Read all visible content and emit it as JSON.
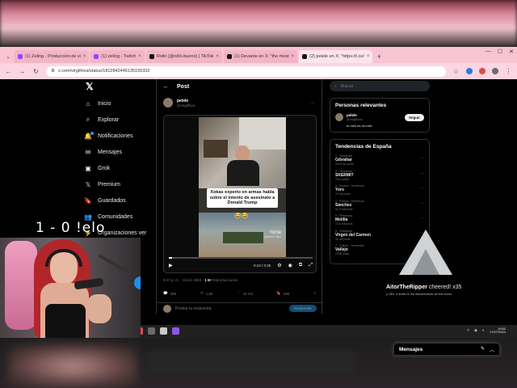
{
  "browser": {
    "tabs": [
      {
        "label": "(1) Zeling - Producción de vi",
        "color": "#9146ff",
        "active": false
      },
      {
        "label": "(1) zeling - Twitch",
        "color": "#9146ff",
        "active": false
      },
      {
        "label": "Rollo (@rollo.bueno) | TikTok",
        "color": "#111111",
        "active": false
      },
      {
        "label": "(1) Devante en X: \"the most",
        "color": "#111111",
        "active": false
      },
      {
        "label": "(2) pelele en X: \"https://t.co/",
        "color": "#111111",
        "active": true
      }
    ],
    "new_tab": "+",
    "url": "x.com/virgilhiva/status/1812842445135155332"
  },
  "xnav": {
    "logo": "𝕏",
    "items": [
      {
        "label": "Inicio",
        "icon": "⌂"
      },
      {
        "label": "Explorar",
        "icon": "⌕"
      },
      {
        "label": "Notificaciones",
        "icon": "🔔"
      },
      {
        "label": "Mensajes",
        "icon": "✉"
      },
      {
        "label": "Grok",
        "icon": "▣"
      },
      {
        "label": "Premium",
        "icon": "𝕏"
      },
      {
        "label": "Guardados",
        "icon": "🔖"
      },
      {
        "label": "Comunidades",
        "icon": "👥"
      },
      {
        "label": "Organizaciones ver",
        "icon": "⚡"
      }
    ]
  },
  "post": {
    "header": "Post",
    "author_name": "pelele",
    "author_handle": "@virgilhiva",
    "embed_name": "pelele",
    "embed_handle": "@virgilhiva",
    "caption": "Xokas experto en armas habla sobre el intento de asesinato a Donald Trump",
    "emojis": "😂😂",
    "tiktok_label": "TikTok",
    "tiktok_user": "@pelele.clips",
    "progress": 0.02,
    "time": "0:13 / 0:26",
    "meta_time": "8:47 p. m. · 18 jul. 2024 · ",
    "meta_views": "1 M",
    "meta_views_label": " Reproducciones",
    "stats": {
      "replies": "355",
      "reposts": "1,6K",
      "likes": "18 mil",
      "bookmarks": "566"
    },
    "reply_placeholder": "Postea tu respuesta",
    "reply_button": "Responder"
  },
  "sidebar": {
    "search_placeholder": "Buscar",
    "relevant_title": "Personas relevantes",
    "relevant": {
      "name": "pelele",
      "handle": "@virgilhiva",
      "bio": "tu rollo es un rollo",
      "follow": "Seguir"
    },
    "trends_title": "Tendencias de España",
    "trends": [
      {
        "cat": "1 · Tendencia",
        "title": "Gibraltar",
        "count": "3318 mil posts"
      },
      {
        "cat": "2 · Tendencia",
        "title": "SKERMIT",
        "count": "7412 posts"
      },
      {
        "cat": "3 · Política · Tendencia",
        "title": "Yoro",
        "count": "12 mil posts"
      },
      {
        "cat": "4 · Política · Tendencia",
        "title": "Sánchez",
        "count": "52,9 mil posts"
      },
      {
        "cat": "5 · Tendencia",
        "title": "Melilla",
        "count": "10,6 mil posts"
      },
      {
        "cat": "6 · Tendencia",
        "title": "Virgen del Carmen",
        "count": "34 mil posts"
      },
      {
        "cat": "7 · Cultura · Tendencia",
        "title": "Vallejo",
        "count": "2398 posts"
      }
    ]
  },
  "cheer": {
    "user": "AitorTheRipper",
    "verb": " cheered! ",
    "amount": "x35",
    "message": "y. Sillo, el tiroteo lo iba descambiando de tirar mores"
  },
  "messages_dock": {
    "label": "Mensajes"
  },
  "taskbar": {
    "time": "19:52",
    "date": "17/07/2024"
  },
  "overlay": {
    "score": "1 - 0 !elo"
  }
}
